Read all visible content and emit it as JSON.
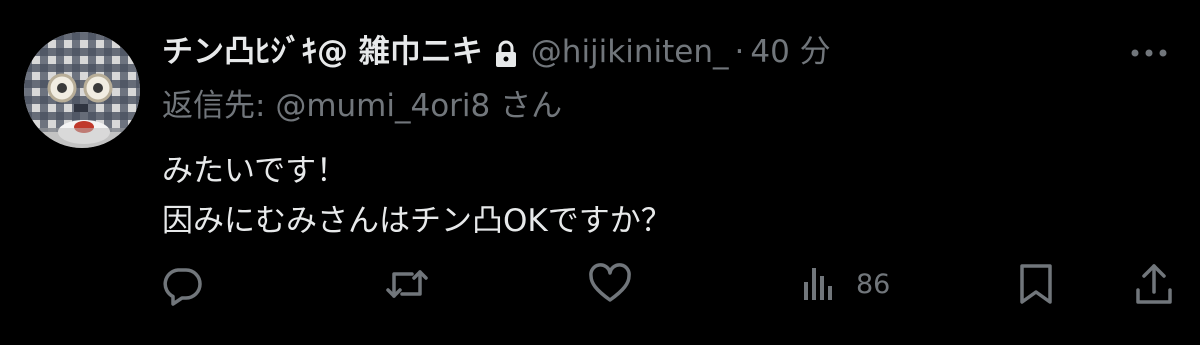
{
  "tweet": {
    "display_name": "チン凸ﾋｼﾞｷ@ 雑巾ニキ",
    "handle": "@hijikiniten_",
    "separator": "·",
    "time": "40 分",
    "reply_prefix": "返信先:",
    "reply_mention": "@mumi_4ori8",
    "reply_suffix": "さん",
    "lines": [
      "みたいです！",
      "因みにむみさんはチン凸OKですか？"
    ],
    "views_count": "86"
  },
  "icons": {
    "lock": "lock-icon",
    "more": "more-icon",
    "reply": "reply-icon",
    "retweet": "retweet-icon",
    "like": "like-icon",
    "views": "views-icon",
    "bookmark": "bookmark-icon",
    "share": "share-icon"
  },
  "colors": {
    "background": "#000000",
    "text": "#e7e9ea",
    "muted": "#71767b"
  }
}
